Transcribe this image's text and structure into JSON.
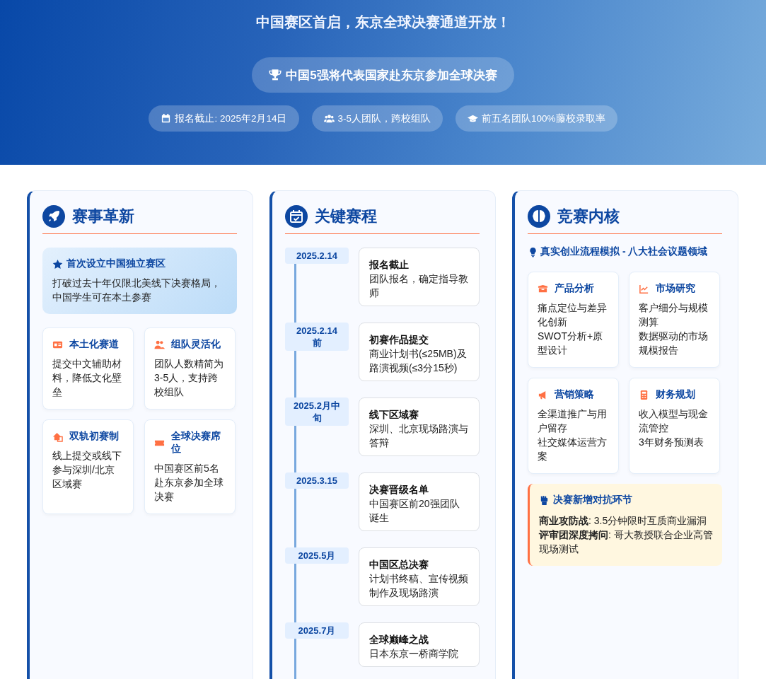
{
  "hero": {
    "headline": "中国赛区首启，东京全球决赛通道开放！",
    "badge": "中国5强将代表国家赴东京参加全球决赛",
    "chips": [
      {
        "text": "报名截止: 2025年2月14日"
      },
      {
        "text": "3-5人团队，跨校组队"
      },
      {
        "text": "前五名团队100%藤校录取率"
      }
    ]
  },
  "innovation": {
    "title": "赛事革新",
    "highlight": {
      "title": "首次设立中国独立赛区",
      "text": "打破过去十年仅限北美线下决赛格局，中国学生可在本土参赛"
    },
    "features": [
      {
        "title": "本土化赛道",
        "text": "提交中文辅助材料，降低文化壁垒"
      },
      {
        "title": "组队灵活化",
        "text": "团队人数精简为3-5人，支持跨校组队"
      },
      {
        "title": "双轨初赛制",
        "text": "线上提交或线下参与深圳/北京区域赛"
      },
      {
        "title": "全球决赛席位",
        "text": "中国赛区前5名赴东京参加全球决赛"
      }
    ]
  },
  "schedule": {
    "title": "关键赛程",
    "events": [
      {
        "date": "2025.2.14",
        "title": "报名截止",
        "text": "团队报名，确定指导教师"
      },
      {
        "date": "2025.2.14前",
        "title": "初赛作品提交",
        "text": "商业计划书(≤25MB)及路演视频(≤3分15秒)"
      },
      {
        "date": "2025.2月中旬",
        "title": "线下区域赛",
        "text": "深圳、北京现场路演与答辩"
      },
      {
        "date": "2025.3.15",
        "title": "决赛晋级名单",
        "text": "中国赛区前20强团队诞生"
      },
      {
        "date": "2025.5月",
        "title": "中国区总决赛",
        "text": "计划书终稿、宣传视频制作及现场路演"
      },
      {
        "date": "2025.7月",
        "title": "全球巅峰之战",
        "text": "日本东京一桥商学院"
      }
    ]
  },
  "core": {
    "title": "竞赛内核",
    "subtitle": "真实创业流程模拟 - 八大社会议题领域",
    "modules": [
      {
        "title": "产品分析",
        "lines": [
          "痛点定位与差异化创新",
          "SWOT分析+原型设计"
        ]
      },
      {
        "title": "市场研究",
        "lines": [
          "客户细分与规模测算",
          "数据驱动的市场规模报告"
        ]
      },
      {
        "title": "营销策略",
        "lines": [
          "全渠道推广与用户留存",
          "社交媒体运营方案"
        ]
      },
      {
        "title": "财务规划",
        "lines": [
          "收入模型与现金流管控",
          "3年财务预测表"
        ]
      }
    ],
    "finale": {
      "title": "决赛新增对抗环节",
      "items": [
        "**商业攻防战**: 3.5分钟限时互质商业漏洞",
        "**评审团深度拷问**: 哥大教授联合企业高管现场测试"
      ]
    }
  }
}
